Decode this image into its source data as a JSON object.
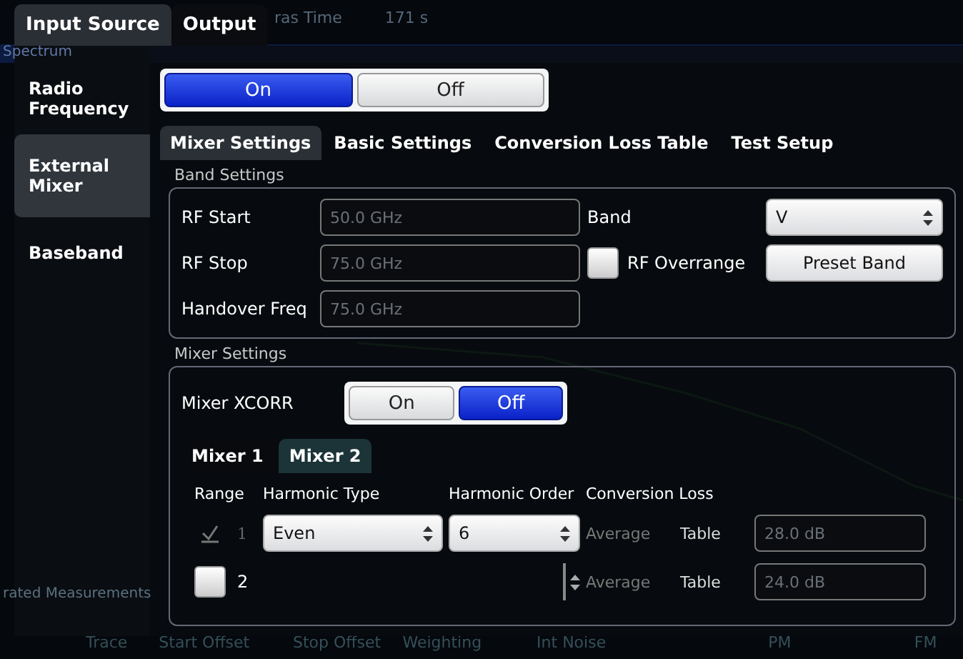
{
  "background": {
    "header_texts": [
      "ras Time",
      "171 s"
    ],
    "spectrum_title": "Spectrum",
    "measurement_title": "rated Measurements",
    "measurement_columns": [
      "Trace",
      "Start Offset",
      "Stop Offset",
      "Weighting",
      "Int Noise",
      "PM",
      "FM"
    ]
  },
  "top_tabs": [
    {
      "label": "Input Source",
      "selected": true
    },
    {
      "label": "Output",
      "selected": false
    }
  ],
  "side_tabs": [
    {
      "label": "Radio Frequency",
      "selected": false
    },
    {
      "label": "External Mixer",
      "selected": true
    },
    {
      "label": "Baseband",
      "selected": false
    }
  ],
  "external_mixer": {
    "options": [
      {
        "label": "On",
        "selected": true
      },
      {
        "label": "Off",
        "selected": false
      }
    ]
  },
  "sub_tabs": [
    {
      "label": "Mixer Settings",
      "selected": true
    },
    {
      "label": "Basic Settings",
      "selected": false
    },
    {
      "label": "Conversion Loss Table",
      "selected": false
    },
    {
      "label": "Test Setup",
      "selected": false
    }
  ],
  "band_settings": {
    "title": "Band Settings",
    "fields": [
      {
        "label": "RF Start",
        "value": "50.0 GHz"
      },
      {
        "label": "RF Stop",
        "value": "75.0 GHz"
      },
      {
        "label": "Handover Freq",
        "value": "75.0 GHz"
      }
    ],
    "band": {
      "label": "Band",
      "value": "V"
    },
    "rf_overrange": {
      "label": "RF Overrange",
      "checked": false
    },
    "preset_button": "Preset Band"
  },
  "mixer_settings": {
    "title": "Mixer Settings",
    "xcorr": {
      "label": "Mixer XCORR",
      "options": [
        {
          "label": "On",
          "selected": false
        },
        {
          "label": "Off",
          "selected": true
        }
      ]
    },
    "mixer_tabs": [
      {
        "label": "Mixer 1",
        "selected": false
      },
      {
        "label": "Mixer 2",
        "selected": true
      }
    ],
    "columns": [
      "Range",
      "Harmonic Type",
      "Harmonic Order",
      "Conversion Loss"
    ],
    "rows": [
      {
        "range": "1",
        "checked": true,
        "disabled": true,
        "harmonic_type": "Even",
        "harmonic_order": "6",
        "mode": "Average",
        "source": "Table",
        "loss": "28.0 dB"
      },
      {
        "range": "2",
        "checked": false,
        "disabled": false,
        "mode": "Average",
        "source": "Table",
        "loss": "24.0 dB"
      }
    ]
  }
}
